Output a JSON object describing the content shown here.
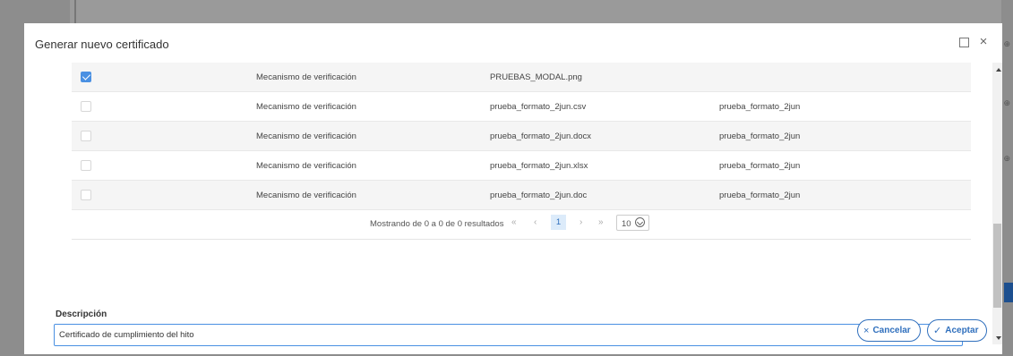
{
  "modal": {
    "title": "Generar nuevo certificado",
    "expand_icon": "expand-icon",
    "close_icon": "close-icon"
  },
  "table": {
    "rows": [
      {
        "checked": true,
        "type": "Mecanismo de verificación",
        "file": "PRUEBAS_MODAL.png",
        "name": ""
      },
      {
        "checked": false,
        "type": "Mecanismo de verificación",
        "file": "prueba_formato_2jun.csv",
        "name": "prueba_formato_2jun"
      },
      {
        "checked": false,
        "type": "Mecanismo de verificación",
        "file": "prueba_formato_2jun.docx",
        "name": "prueba_formato_2jun"
      },
      {
        "checked": false,
        "type": "Mecanismo de verificación",
        "file": "prueba_formato_2jun.xlsx",
        "name": "prueba_formato_2jun"
      },
      {
        "checked": false,
        "type": "Mecanismo de verificación",
        "file": "prueba_formato_2jun.doc",
        "name": "prueba_formato_2jun"
      }
    ]
  },
  "pager": {
    "summary": "Mostrando de 0 a 0 de 0 resultados",
    "first": "«",
    "prev": "‹",
    "current": "1",
    "next": "›",
    "last": "»",
    "page_size": "10"
  },
  "description": {
    "label": "Descripción",
    "value": "Certificado de cumplimiento del hito"
  },
  "actions": {
    "cancel_icon": "×",
    "cancel_label": "Cancelar",
    "accept_icon": "✓",
    "accept_label": "Aceptar"
  },
  "colors": {
    "accent": "#2f6fbd",
    "checkbox_checked": "#4a90e2",
    "focus_border": "#4a90e2"
  }
}
